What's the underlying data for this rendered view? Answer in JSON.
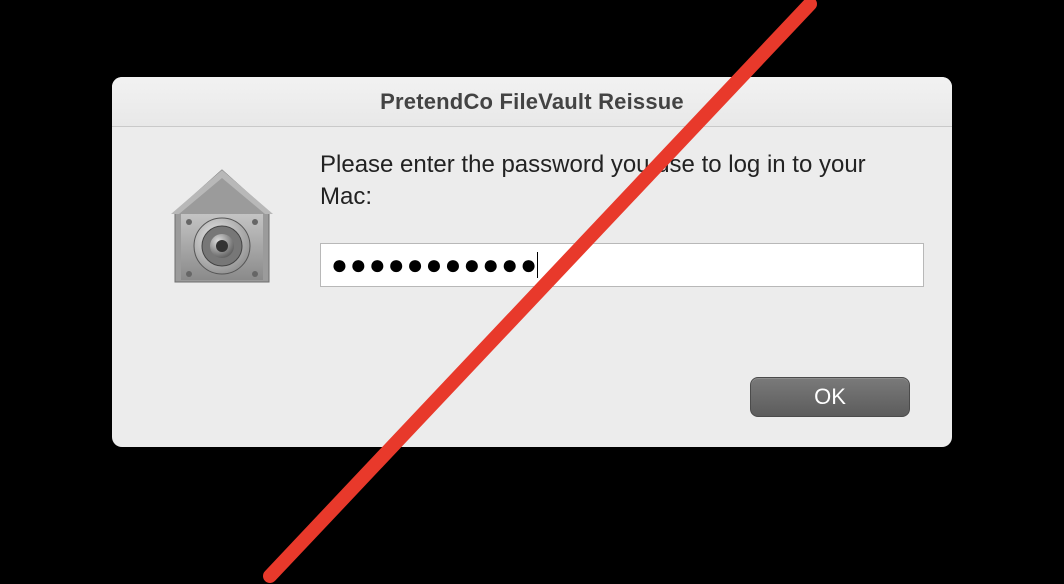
{
  "dialog": {
    "title": "PretendCo FileVault Reissue",
    "prompt": "Please enter the password you use to log in to your Mac:",
    "password_masked": "●●●●●●●●●●●",
    "ok_label": "OK"
  },
  "icon_name": "filevault-icon",
  "overlay": "red-strike-line"
}
